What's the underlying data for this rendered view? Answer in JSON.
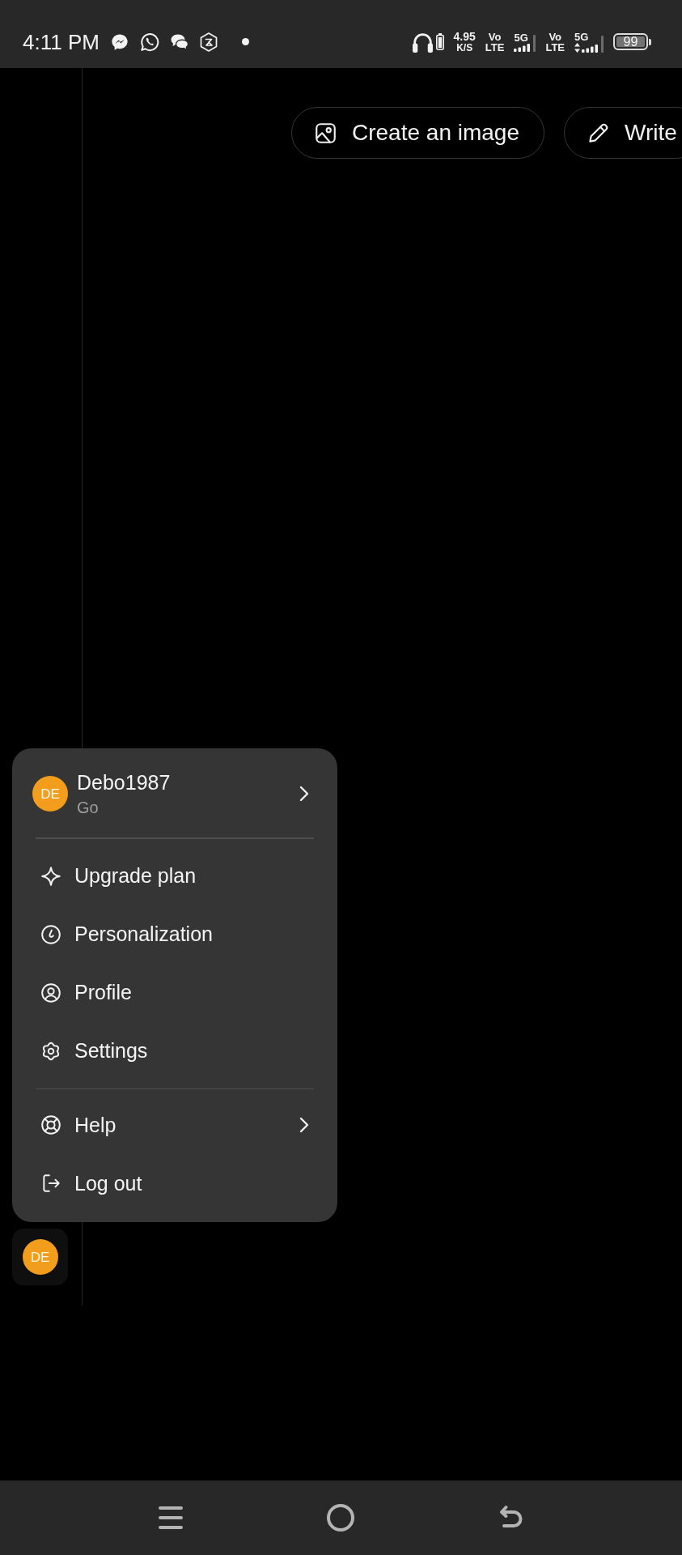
{
  "status_bar": {
    "time": "4:11 PM",
    "network_speed": {
      "value": "4.95",
      "unit": "K/S"
    },
    "sims": [
      {
        "volte_lines": [
          "Vo",
          "LTE"
        ],
        "network": "5G",
        "data_activity": false
      },
      {
        "volte_lines": [
          "Vo",
          "LTE"
        ],
        "network": "5G",
        "data_activity": true
      }
    ],
    "battery": "99"
  },
  "suggestion_chips": [
    {
      "kind": "image",
      "label": "Create an image"
    },
    {
      "kind": "write",
      "label": "Write"
    }
  ],
  "account_menu": {
    "account": {
      "initials": "DE",
      "name": "Debo1987",
      "plan": "Go",
      "submenu": true
    },
    "sections": [
      [
        {
          "kind": "upgrade",
          "label": "Upgrade plan",
          "submenu": false
        },
        {
          "kind": "personalization",
          "label": "Personalization",
          "submenu": false
        },
        {
          "kind": "profile",
          "label": "Profile",
          "submenu": false
        },
        {
          "kind": "settings",
          "label": "Settings",
          "submenu": false
        }
      ],
      [
        {
          "kind": "help",
          "label": "Help",
          "submenu": true
        },
        {
          "kind": "logout",
          "label": "Log out",
          "submenu": false
        }
      ]
    ]
  },
  "sidebar": {
    "account_initials": "DE"
  }
}
